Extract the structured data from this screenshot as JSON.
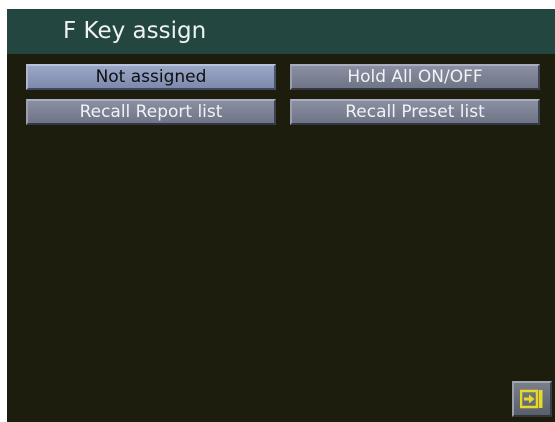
{
  "window": {
    "title": "F Key assign"
  },
  "assign_options": [
    {
      "label": "Not assigned",
      "selected": true
    },
    {
      "label": "Hold All ON/OFF",
      "selected": false
    },
    {
      "label": "Recall Report list",
      "selected": false
    },
    {
      "label": "Recall Preset list",
      "selected": false
    }
  ],
  "footer": {
    "exit_icon": "exit-icon"
  },
  "colors": {
    "background": "#1c1d0c",
    "title_bar": "#244640",
    "selected_button": "#8e9abb",
    "button": "#7c8294",
    "exit_icon_accent": "#e8d82a"
  }
}
